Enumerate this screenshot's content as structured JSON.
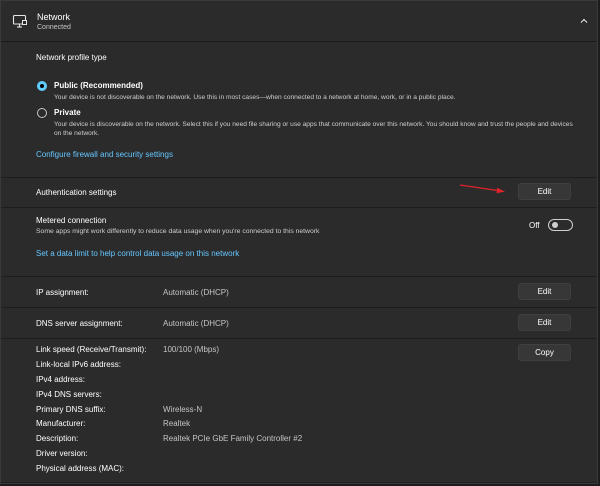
{
  "header": {
    "title": "Network",
    "subtitle": "Connected"
  },
  "profile": {
    "heading": "Network profile type",
    "public": {
      "label": "Public (Recommended)",
      "desc": "Your device is not discoverable on the network. Use this in most cases—when connected to a network at home, work, or in a public place.",
      "selected": true
    },
    "private": {
      "label": "Private",
      "desc": "Your device is discoverable on the network. Select this if you need file sharing or use apps that communicate over this network. You should know and trust the people and devices on the network.",
      "selected": false
    },
    "firewall_link": "Configure firewall and security settings"
  },
  "auth": {
    "label": "Authentication settings",
    "button": "Edit"
  },
  "metered": {
    "label": "Metered connection",
    "desc": "Some apps might work differently to reduce data usage when you're connected to this network",
    "toggle_state": "Off",
    "data_limit_link": "Set a data limit to help control data usage on this network"
  },
  "ip": {
    "label": "IP assignment:",
    "value": "Automatic (DHCP)",
    "button": "Edit"
  },
  "dns": {
    "label": "DNS server assignment:",
    "value": "Automatic (DHCP)",
    "button": "Edit"
  },
  "properties": {
    "copy_button": "Copy",
    "rows": [
      {
        "label": "Link speed (Receive/Transmit):",
        "value": "100/100 (Mbps)"
      },
      {
        "label": "Link-local IPv6 address:",
        "value": ""
      },
      {
        "label": "IPv4 address:",
        "value": ""
      },
      {
        "label": "IPv4 DNS servers:",
        "value": ""
      },
      {
        "label": "Primary DNS suffix:",
        "value": "Wireless-N"
      },
      {
        "label": "Manufacturer:",
        "value": "Realtek"
      },
      {
        "label": "Description:",
        "value": "Realtek PCIe GbE Family Controller #2"
      },
      {
        "label": "Driver version:",
        "value": ""
      },
      {
        "label": "Physical address (MAC):",
        "value": ""
      }
    ]
  },
  "colors": {
    "accent": "#60cdff",
    "link": "#66c6ff",
    "annotation_arrow": "#e0232b"
  },
  "icons": {
    "header": "network-monitor-icon",
    "collapse": "chevron-up-icon"
  }
}
